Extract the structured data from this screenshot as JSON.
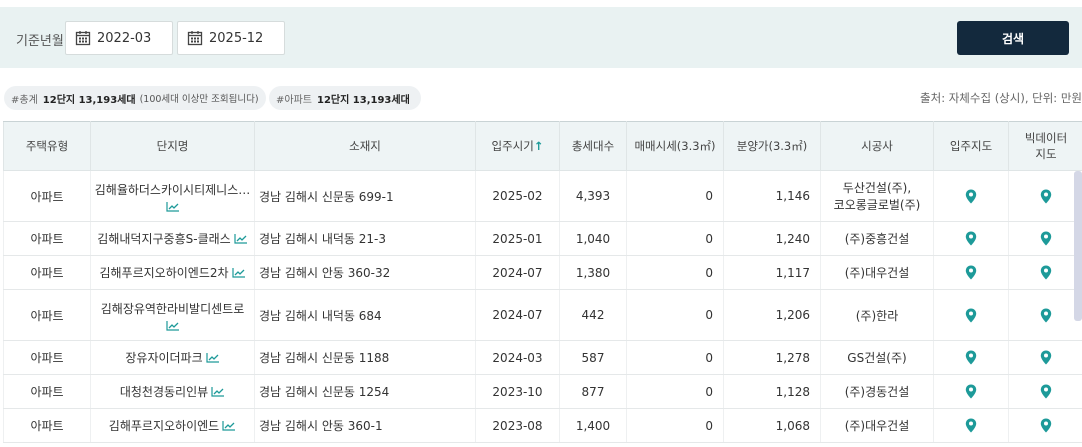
{
  "filter": {
    "label": "기준년월",
    "from": "2022-03",
    "to": "2025-12",
    "search_button": "검색"
  },
  "summary": {
    "total_tag": "#총계",
    "total_value": "12단지 13,193세대",
    "total_note": "(100세대 이상만 조회됩니다)",
    "apt_tag": "#아파트",
    "apt_value": "12단지 13,193세대",
    "source": "출처: 자체수집 (상시), 단위: 만원"
  },
  "table": {
    "headers": {
      "type": "주택유형",
      "name": "단지명",
      "address": "소재지",
      "move_in": "입주시기",
      "households": "총세대수",
      "sale_price": "매매시세(3.3㎡)",
      "presale_price": "분양가(3.3㎡)",
      "builder": "시공사",
      "map": "입주지도",
      "bigdata_map_line1": "빅데이터",
      "bigdata_map_line2": "지도"
    },
    "rows": [
      {
        "type": "아파트",
        "name": "김해율하더스카이시티제니스…",
        "address": "경남 김해시 신문동 699-1",
        "move_in": "2025-02",
        "households": "4,393",
        "sale_price": "0",
        "presale_price": "1,146",
        "builder_line1": "두산건설(주),",
        "builder_line2": "코오롱글로벌(주)"
      },
      {
        "type": "아파트",
        "name": "김해내덕지구중흥S-클래스",
        "address": "경남 김해시 내덕동 21-3",
        "move_in": "2025-01",
        "households": "1,040",
        "sale_price": "0",
        "presale_price": "1,240",
        "builder_line1": "(주)중흥건설",
        "builder_line2": ""
      },
      {
        "type": "아파트",
        "name": "김해푸르지오하이엔드2차",
        "address": "경남 김해시 안동 360-32",
        "move_in": "2024-07",
        "households": "1,380",
        "sale_price": "0",
        "presale_price": "1,117",
        "builder_line1": "(주)대우건설",
        "builder_line2": ""
      },
      {
        "type": "아파트",
        "name": "김해장유역한라비발디센트로",
        "address": "경남 김해시 내덕동 684",
        "move_in": "2024-07",
        "households": "442",
        "sale_price": "0",
        "presale_price": "1,206",
        "builder_line1": "(주)한라",
        "builder_line2": ""
      },
      {
        "type": "아파트",
        "name": "장유자이더파크",
        "address": "경남 김해시 신문동 1188",
        "move_in": "2024-03",
        "households": "587",
        "sale_price": "0",
        "presale_price": "1,278",
        "builder_line1": "GS건설(주)",
        "builder_line2": ""
      },
      {
        "type": "아파트",
        "name": "대청천경동리인뷰",
        "address": "경남 김해시 신문동 1254",
        "move_in": "2023-10",
        "households": "877",
        "sale_price": "0",
        "presale_price": "1,128",
        "builder_line1": "(주)경동건설",
        "builder_line2": ""
      },
      {
        "type": "아파트",
        "name": "김해푸르지오하이엔드",
        "address": "경남 김해시 안동 360-1",
        "move_in": "2023-08",
        "households": "1,400",
        "sale_price": "0",
        "presale_price": "1,068",
        "builder_line1": "(주)대우건설",
        "builder_line2": ""
      }
    ]
  },
  "colors": {
    "accent": "#1d9a99",
    "button": "#13293d",
    "filter_bg": "#e9f2f2",
    "header_bg": "#eef4f5"
  },
  "icons": {
    "calendar": "calendar-icon",
    "trend": "trend-chart-icon",
    "map_pin": "map-pin-icon",
    "sort": "sort-up-arrow-icon"
  }
}
